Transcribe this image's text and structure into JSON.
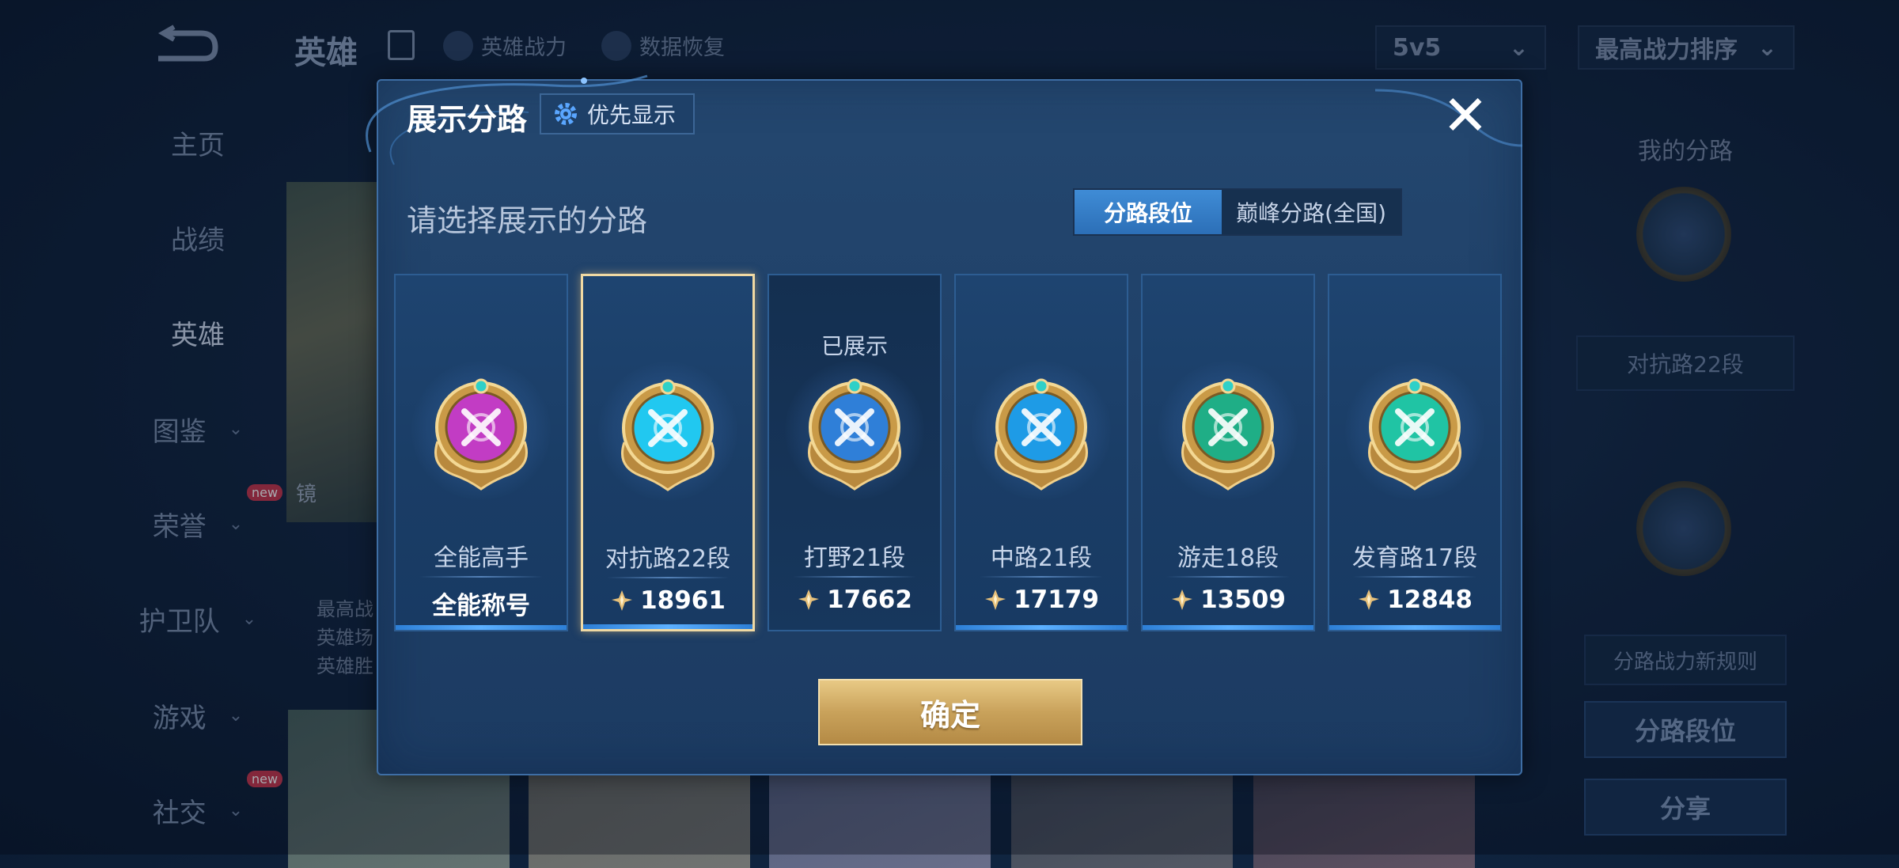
{
  "background": {
    "title": "英雄",
    "tools": [
      "英雄战力",
      "数据恢复"
    ],
    "mode_select": "5v5",
    "sort_select": "最高战力排序",
    "nav": [
      "主页",
      "战绩",
      "英雄",
      "图鉴",
      "荣誉",
      "护卫队",
      "游戏",
      "社交"
    ],
    "new_badge": "new",
    "hero_name": "镜",
    "hero_info": [
      "最高战",
      "英雄场",
      "英雄胜"
    ],
    "right_panel": {
      "title": "我的分路",
      "current_lane": "对抗路22段",
      "rules_link": "分路战力新规则",
      "lane_rank_button": "分路段位",
      "share_button": "分享"
    }
  },
  "modal": {
    "title": "展示分路",
    "priority_button": "优先显示",
    "subtitle": "请选择展示的分路",
    "tabs": [
      {
        "label": "分路段位",
        "active": true
      },
      {
        "label": "巅峰分路(全国)",
        "active": false
      }
    ],
    "cards": [
      {
        "name": "全能高手",
        "value": "全能称号",
        "has_power": false,
        "selected": false,
        "shown_label": "",
        "emblem": "allround-emblem-icon",
        "color": "#c23cc4"
      },
      {
        "name": "对抗路22段",
        "value": "18961",
        "has_power": true,
        "selected": true,
        "shown_label": "",
        "emblem": "clash-lane-emblem-icon",
        "color": "#21c8f0"
      },
      {
        "name": "打野21段",
        "value": "17662",
        "has_power": true,
        "selected": false,
        "shown_label": "已展示",
        "emblem": "jungle-emblem-icon",
        "color": "#2f7fd8"
      },
      {
        "name": "中路21段",
        "value": "17179",
        "has_power": true,
        "selected": false,
        "shown_label": "",
        "emblem": "mid-lane-emblem-icon",
        "color": "#1e9be6"
      },
      {
        "name": "游走18段",
        "value": "13509",
        "has_power": true,
        "selected": false,
        "shown_label": "",
        "emblem": "roam-emblem-icon",
        "color": "#1fae86"
      },
      {
        "name": "发育路17段",
        "value": "12848",
        "has_power": true,
        "selected": false,
        "shown_label": "",
        "emblem": "farm-lane-emblem-icon",
        "color": "#20c4a4"
      }
    ],
    "confirm_button": "确定"
  }
}
